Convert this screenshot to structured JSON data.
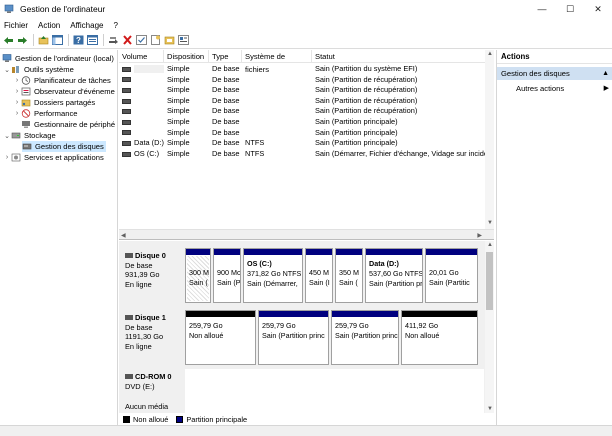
{
  "window": {
    "title": "Gestion de l'ordinateur",
    "minimize": "—",
    "maximize": "☐",
    "close": "✕"
  },
  "menu": [
    "Fichier",
    "Action",
    "Affichage",
    "?"
  ],
  "tree": {
    "root": "Gestion de l'ordinateur (local)",
    "outils": "Outils système",
    "planificateur": "Planificateur de tâches",
    "observateur": "Observateur d'événeme",
    "dossiers": "Dossiers partagés",
    "performance": "Performance",
    "peripheriques": "Gestionnaire de périphé",
    "stockage": "Stockage",
    "gestion_disques": "Gestion des disques",
    "services": "Services et applications"
  },
  "volume_table": {
    "headers": [
      "Volume",
      "Disposition",
      "Type",
      "Système de fichiers",
      "Statut"
    ],
    "rows": [
      {
        "volume": "",
        "disp": "Simple",
        "type": "De base",
        "fs": "",
        "status": "Sain (Partition du système EFI)"
      },
      {
        "volume": "",
        "disp": "Simple",
        "type": "De base",
        "fs": "",
        "status": "Sain (Partition de récupération)"
      },
      {
        "volume": "",
        "disp": "Simple",
        "type": "De base",
        "fs": "",
        "status": "Sain (Partition de récupération)"
      },
      {
        "volume": "",
        "disp": "Simple",
        "type": "De base",
        "fs": "",
        "status": "Sain (Partition de récupération)"
      },
      {
        "volume": "",
        "disp": "Simple",
        "type": "De base",
        "fs": "",
        "status": "Sain (Partition de récupération)"
      },
      {
        "volume": "",
        "disp": "Simple",
        "type": "De base",
        "fs": "",
        "status": "Sain (Partition principale)"
      },
      {
        "volume": "",
        "disp": "Simple",
        "type": "De base",
        "fs": "",
        "status": "Sain (Partition principale)"
      },
      {
        "volume": "Data (D:)",
        "disp": "Simple",
        "type": "De base",
        "fs": "NTFS",
        "status": "Sain (Partition principale)"
      },
      {
        "volume": "OS (C:)",
        "disp": "Simple",
        "type": "De base",
        "fs": "NTFS",
        "status": "Sain (Démarrer, Fichier d'échange, Vidage sur incidem"
      }
    ]
  },
  "disks": {
    "disk0": {
      "name": "Disque 0",
      "type": "De base",
      "size": "931,39 Go",
      "status": "En ligne",
      "partitions": [
        {
          "l1": "300 M",
          "l2": "Sain (",
          "name": ""
        },
        {
          "l1": "900 Mo",
          "l2": "Sain (P",
          "name": ""
        },
        {
          "name": "OS  (C:)",
          "l1": "371,82 Go NTFS",
          "l2": "Sain (Démarrer,"
        },
        {
          "l1": "450 M",
          "l2": "Sain (I",
          "name": ""
        },
        {
          "l1": "350 M",
          "l2": "Sain (",
          "name": ""
        },
        {
          "name": "Data  (D:)",
          "l1": "537,60 Go NTFS",
          "l2": "Sain (Partition pr"
        },
        {
          "l1": "20,01 Go",
          "l2": "Sain (Partitic",
          "name": ""
        }
      ]
    },
    "disk1": {
      "name": "Disque 1",
      "type": "De base",
      "size": "1191,30 Go",
      "status": "En ligne",
      "partitions": [
        {
          "l1": "259,79 Go",
          "l2": "Non alloué"
        },
        {
          "l1": "259,79 Go",
          "l2": "Sain (Partition princ"
        },
        {
          "l1": "259,79 Go",
          "l2": "Sain (Partition princ"
        },
        {
          "l1": "411,92 Go",
          "l2": "Non alloué"
        }
      ]
    },
    "cdrom": {
      "name": "CD-ROM 0",
      "type": "DVD (E:)",
      "media": "Aucun média"
    }
  },
  "legend": {
    "unallocated": "Non alloué",
    "primary": "Partition principale",
    "unallocated_color": "#000000",
    "primary_color": "#00007f"
  },
  "actions": {
    "title": "Actions",
    "section": "Gestion des disques",
    "more": "Autres actions"
  },
  "colors": {
    "selection": "#cce8ff",
    "action_section": "#cfe0f2",
    "primary_bar": "#00007f",
    "unallocated_bar": "#000000"
  }
}
